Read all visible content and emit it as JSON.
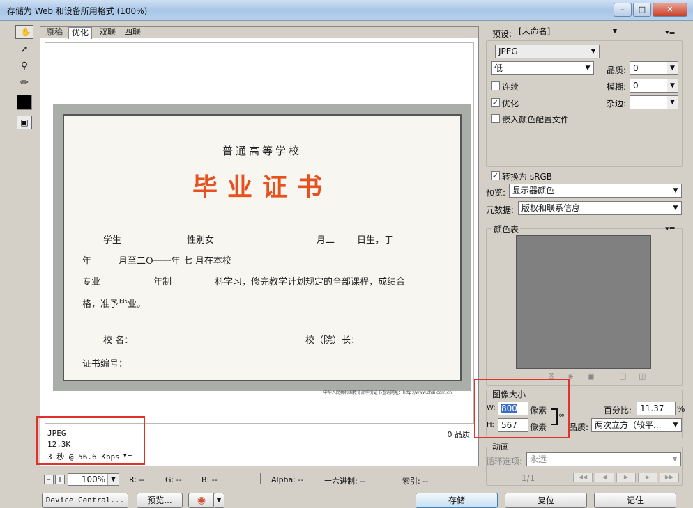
{
  "window": {
    "title": "存储为 Web 和设备所用格式 (100%)"
  },
  "tabs": [
    "原稿",
    "优化",
    "双联",
    "四联"
  ],
  "certificate": {
    "school": "普通高等学校",
    "heading": "毕业证书",
    "line1a": "学生",
    "line1b": "性别女",
    "line1c": "月二",
    "line1d": "日生，于",
    "line2a": "年",
    "line2b": "月至二O一一年 七 月在本校",
    "line3a": "专业",
    "line3b": "年制",
    "line3c": "科学习，修完教学计划规定的全部课程，成绩合",
    "line4": "格，准予毕业。",
    "line5a": "校    名：",
    "line5b": "校（院）长：",
    "line6": "证书编号：",
    "footer": "中华人民共和国教育部学历证书查询网址：http://www.chsi.com.cn"
  },
  "info": {
    "format": "JPEG",
    "size": "12.3K",
    "speed": "3 秒 @ 56.6 Kbps",
    "quality": "0 品质"
  },
  "bottom_bar": {
    "zoom": "100%",
    "r": "R: --",
    "g": "G: --",
    "b": "B: --",
    "alpha": "Alpha: --",
    "hex": "十六进制: --",
    "index": "索引: --"
  },
  "preset": {
    "label": "预设:",
    "value": "[未命名]"
  },
  "format": {
    "value": "JPEG"
  },
  "quality_level": {
    "value": "低"
  },
  "quality": {
    "label": "品质:",
    "value": "0"
  },
  "blur": {
    "label": "模糊:",
    "value": "0"
  },
  "matte": {
    "label": "杂边:",
    "value": ""
  },
  "checks": {
    "progressive": {
      "label": "连续",
      "checked": false
    },
    "optimized": {
      "label": "优化",
      "checked": true
    },
    "icc": {
      "label": "嵌入颜色配置文件",
      "checked": false
    },
    "srgb": {
      "label": "转换为 sRGB",
      "checked": true
    }
  },
  "preview_mode": {
    "label": "预览:",
    "value": "显示器颜色"
  },
  "metadata": {
    "label": "元数据:",
    "value": "版权和联系信息"
  },
  "color_table": {
    "label": "颜色表",
    "color": "#808080"
  },
  "image_size": {
    "label": "图像大小",
    "w_label": "W:",
    "w_value": "800",
    "w_unit": "像素",
    "h_label": "H:",
    "h_value": "567",
    "h_unit": "像素",
    "percent_label": "百分比:",
    "percent_value": "11.37",
    "percent_unit": "%",
    "quality_label": "品质:",
    "quality_value": "两次立方（较平..."
  },
  "animation": {
    "label": "动画",
    "loop_label": "循环选项:",
    "loop_value": "永远",
    "frame": "1/1"
  },
  "buttons": {
    "device_central": "Device Central...",
    "preview": "预览...",
    "save": "存储",
    "reset": "复位",
    "remember": "记住"
  },
  "accent": "#e0312b"
}
